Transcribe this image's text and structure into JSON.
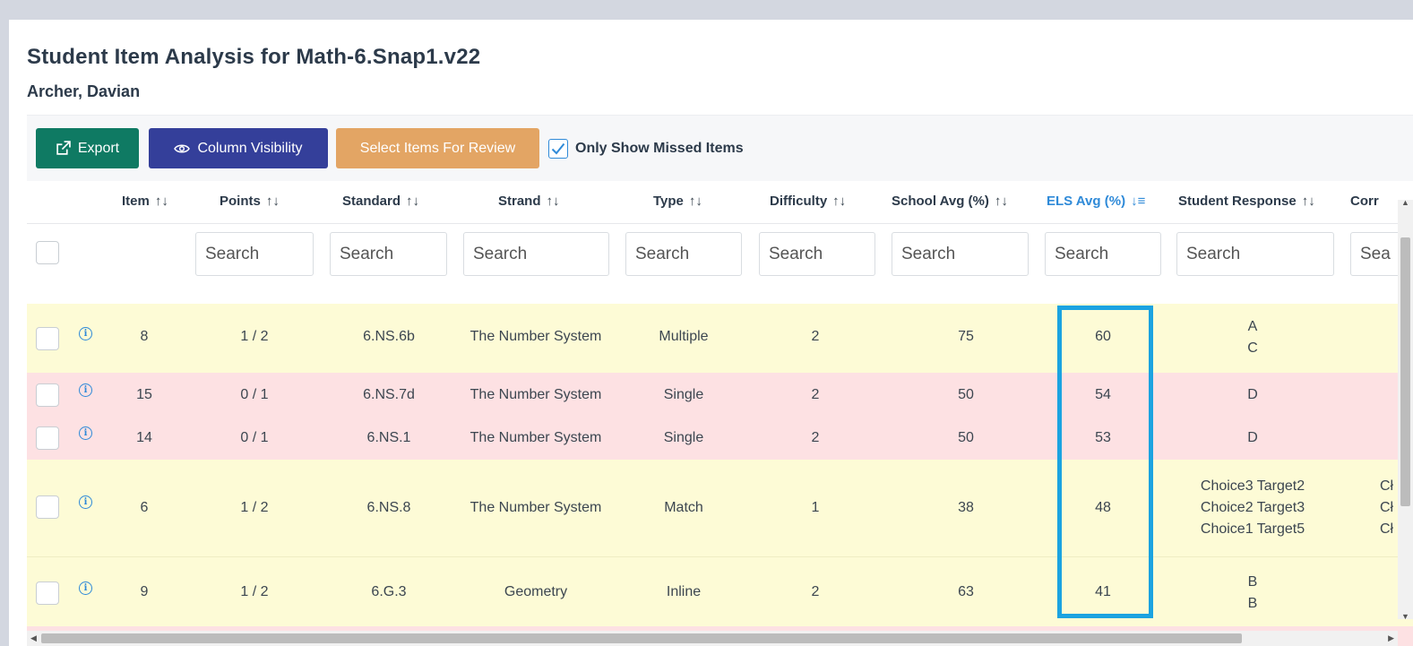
{
  "page": {
    "title": "Student Item Analysis for Math-6.Snap1.v22",
    "student": "Archer, Davian"
  },
  "toolbar": {
    "export_label": "Export",
    "column_visibility_label": "Column Visibility",
    "select_review_label": "Select Items For Review",
    "only_missed_label": "Only Show Missed Items",
    "only_missed_checked": true
  },
  "columns": [
    {
      "label": "Item",
      "sort": "↑↓"
    },
    {
      "label": "Points",
      "sort": "↑↓"
    },
    {
      "label": "Standard",
      "sort": "↑↓"
    },
    {
      "label": "Strand",
      "sort": "↑↓"
    },
    {
      "label": "Type",
      "sort": "↑↓"
    },
    {
      "label": "Difficulty",
      "sort": "↑↓"
    },
    {
      "label": "School Avg (%)",
      "sort": "↑↓"
    },
    {
      "label": "ELS Avg (%)",
      "sort": "↓≡"
    },
    {
      "label": "Student Response",
      "sort": "↑↓"
    },
    {
      "label": "Corr",
      "sort": ""
    }
  ],
  "search_placeholder": "Search",
  "search_placeholder_truncated": "Sea",
  "rows": [
    {
      "item": "8",
      "points": "1 / 2",
      "standard": "6.NS.6b",
      "strand": "The Number System",
      "type": "Multiple",
      "difficulty": "2",
      "school_avg": "75",
      "els_avg": "60",
      "response": [
        "A",
        "C"
      ],
      "correct": []
    },
    {
      "item": "15",
      "points": "0 / 1",
      "standard": "6.NS.7d",
      "strand": "The Number System",
      "type": "Single",
      "difficulty": "2",
      "school_avg": "50",
      "els_avg": "54",
      "response": [
        "D"
      ],
      "correct": []
    },
    {
      "item": "14",
      "points": "0 / 1",
      "standard": "6.NS.1",
      "strand": "The Number System",
      "type": "Single",
      "difficulty": "2",
      "school_avg": "50",
      "els_avg": "53",
      "response": [
        "D"
      ],
      "correct": []
    },
    {
      "item": "6",
      "points": "1 / 2",
      "standard": "6.NS.8",
      "strand": "The Number System",
      "type": "Match",
      "difficulty": "1",
      "school_avg": "38",
      "els_avg": "48",
      "response": [
        "Choice3 Target2",
        "Choice2 Target3",
        "Choice1 Target5"
      ],
      "correct": [
        "Cł",
        "Cł",
        "Cł"
      ]
    },
    {
      "item": "9",
      "points": "1 / 2",
      "standard": "6.G.3",
      "strand": "Geometry",
      "type": "Inline",
      "difficulty": "2",
      "school_avg": "63",
      "els_avg": "41",
      "response": [
        "B",
        "B"
      ],
      "correct": []
    }
  ],
  "colors": {
    "row_partial": "#fdfbd6",
    "row_missed": "#fde1e3",
    "highlight": "#1ba3e0",
    "export_btn": "#0f7a63",
    "colvis_btn": "#343f9a",
    "review_btn": "#e3a564",
    "active_sort": "#2f8ad8"
  }
}
